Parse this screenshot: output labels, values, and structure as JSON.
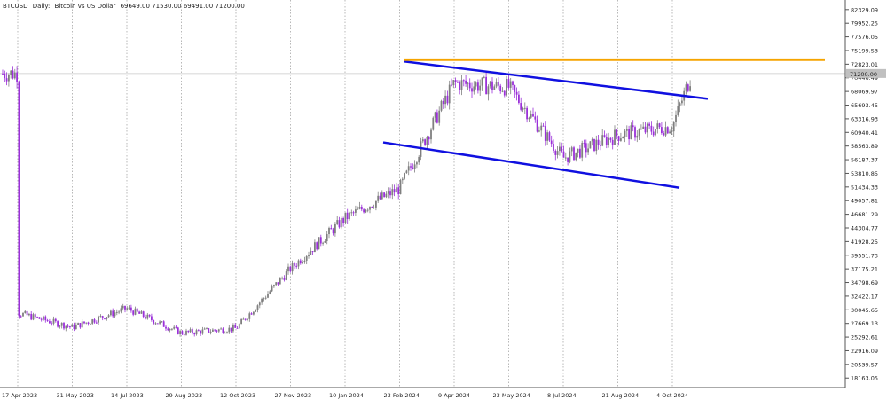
{
  "header": {
    "symbol": "BTCUSD",
    "period": "Daily:",
    "description": "Bitcoin vs US Dollar",
    "ohlc": "69649.00 71530.00 69491.00 71200.00"
  },
  "current_price_label": "71200.00",
  "colors": {
    "bull": "#7f7f7f",
    "bear": "#9b30d9",
    "channel": "#1010e0",
    "resistance": "#f5a400",
    "grid": "#9a9a9a",
    "axis": "#555555"
  },
  "chart_data": {
    "type": "candlestick",
    "instrument": "BTCUSD",
    "timeframe": "Daily",
    "ylim": [
      16500,
      84000
    ],
    "x_ticks": [
      "17 Apr 2023",
      "31 May 2023",
      "14 Jul 2023",
      "29 Aug 2023",
      "12 Oct 2023",
      "27 Nov 2023",
      "10 Jan 2024",
      "23 Feb 2024",
      "9 Apr 2024",
      "23 May 2024",
      "8 Jul 2024",
      "21 Aug 2024",
      "4 Oct 2024"
    ],
    "y_ticks": [
      "82329.09",
      "79952.25",
      "77576.05",
      "75199.53",
      "72823.01",
      "70446.49",
      "68069.97",
      "65693.45",
      "63316.93",
      "60940.41",
      "58563.89",
      "56187.37",
      "53810.85",
      "51434.33",
      "49057.81",
      "46681.29",
      "44304.77",
      "41928.25",
      "39551.73",
      "37175.21",
      "34798.69",
      "32422.17",
      "30045.65",
      "27669.13",
      "25292.61",
      "22916.09",
      "20539.57",
      "18163.05"
    ],
    "price_path": [
      [
        "17 Apr 2023",
        29500
      ],
      [
        "31 May 2023",
        27000
      ],
      [
        "14 Jul 2023",
        30300
      ],
      [
        "29 Aug 2023",
        26000
      ],
      [
        "12 Oct 2023",
        26800
      ],
      [
        "27 Nov 2023",
        37200
      ],
      [
        "10 Jan 2024",
        46000
      ],
      [
        "23 Feb 2024",
        51200
      ],
      [
        "9 Apr 2024",
        69500
      ],
      [
        "23 May 2024",
        68800
      ],
      [
        "8 Jul 2024",
        56500
      ],
      [
        "21 Aug 2024",
        60500
      ],
      [
        "4 Oct 2024",
        62000
      ],
      [
        "last",
        71200
      ]
    ],
    "annotations": [
      {
        "type": "trendline",
        "name": "Channel upper",
        "from": [
          "23 Feb 2024",
          73300
        ],
        "to": [
          "4 Oct 2024",
          66800
        ]
      },
      {
        "type": "trendline",
        "name": "Channel lower",
        "from": [
          "10 Jan 2024",
          59200
        ],
        "to": [
          "4 Oct 2024",
          51300
        ]
      },
      {
        "type": "horizontal",
        "name": "Resistance",
        "price": 73600
      }
    ],
    "grid": true
  }
}
